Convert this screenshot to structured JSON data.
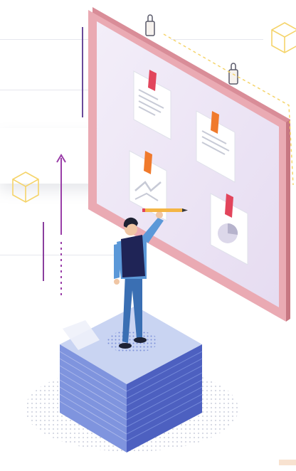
{
  "illustration": {
    "palette": {
      "board_frame": "#e8a4ae",
      "board_face": "#efe7f6",
      "note_paper": "#ffffff",
      "pin_red": "#e2455c",
      "pin_orange": "#f07a2c",
      "cube_stroke": "#f5d46a",
      "purple_line": "#7a3e96",
      "stack_blue": "#5f72c9",
      "person_vest": "#1f2456",
      "person_shirt": "#5b98d8",
      "pencil": "#f4b545"
    },
    "icons": [
      "clipboard-clip-icon",
      "cube-outline-icon",
      "up-arrow-icon",
      "chart-note-icon",
      "pie-chart-note-icon",
      "pencil-icon"
    ]
  }
}
